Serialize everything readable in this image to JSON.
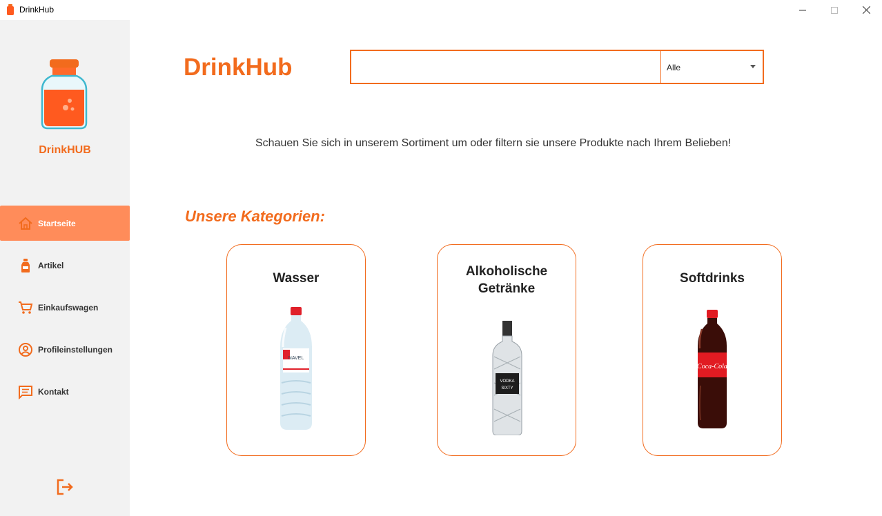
{
  "window": {
    "title": "DrinkHub"
  },
  "sidebar": {
    "brand": "DrinkHUB",
    "items": [
      {
        "label": "Startseite",
        "icon": "home-icon",
        "active": true
      },
      {
        "label": "Artikel",
        "icon": "bottle-icon",
        "active": false
      },
      {
        "label": "Einkaufswagen",
        "icon": "cart-icon",
        "active": false
      },
      {
        "label": "Profileinstellungen",
        "icon": "user-circle-icon",
        "active": false
      },
      {
        "label": "Kontakt",
        "icon": "message-icon",
        "active": false
      }
    ],
    "logout_icon": "logout-icon"
  },
  "header": {
    "brand": "DrinkHub",
    "search": {
      "value": "",
      "placeholder": ""
    },
    "filter": {
      "selected": "Alle"
    }
  },
  "main": {
    "intro": "Schauen Sie sich in unserem Sortiment um oder filtern sie unsere Produkte nach Ihrem Belieben!",
    "categories_heading": "Unsere Kategorien:",
    "categories": [
      {
        "title": "Wasser",
        "image": "water-bottle"
      },
      {
        "title": "Alkoholische Getränke",
        "image": "vodka-bottle"
      },
      {
        "title": "Softdrinks",
        "image": "cola-bottle"
      }
    ]
  },
  "colors": {
    "accent": "#f26b1d",
    "active_nav": "#ff8c5a",
    "sidebar_bg": "#f2f2f2"
  }
}
